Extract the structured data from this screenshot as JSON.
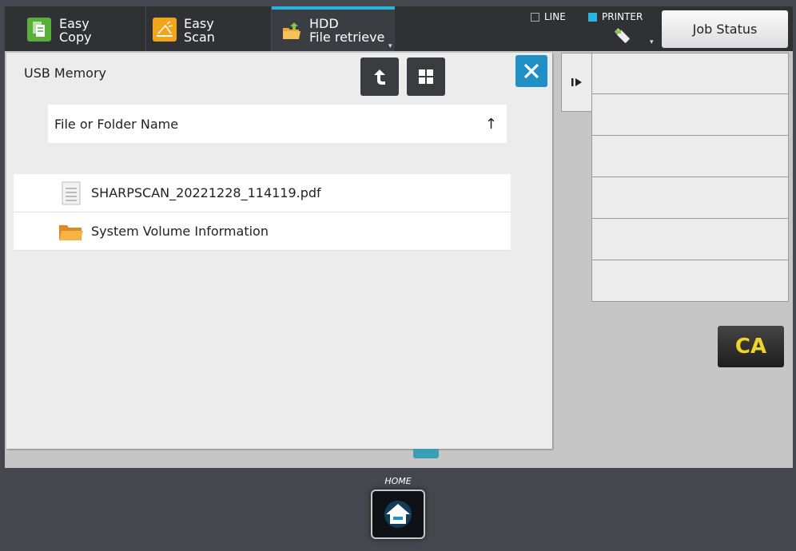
{
  "topbar": {
    "tabs": [
      {
        "label": "Easy\nCopy",
        "icon": "copy-icon"
      },
      {
        "label": "Easy\nScan",
        "icon": "scan-icon"
      },
      {
        "label": "HDD\nFile retrieve",
        "icon": "folder-retrieve-icon"
      }
    ],
    "indicators": {
      "line": "LINE",
      "printer": "PRINTER"
    },
    "job_status": "Job Status"
  },
  "panel": {
    "title": "USB Memory",
    "header": {
      "label": "File or Folder Name",
      "sort_arrow": "↑"
    },
    "items": [
      {
        "name": "SHARPSCAN_20221228_114119.pdf",
        "type": "file"
      },
      {
        "name": "System Volume Information",
        "type": "folder"
      }
    ]
  },
  "right_panel": {
    "slots": [
      "",
      "",
      "",
      "",
      "",
      ""
    ]
  },
  "ca_label": "CA",
  "home_label": "HOME",
  "colors": {
    "accent": "#2ab3dc",
    "close": "#1f8fc5",
    "ca_text": "#f1d526"
  }
}
